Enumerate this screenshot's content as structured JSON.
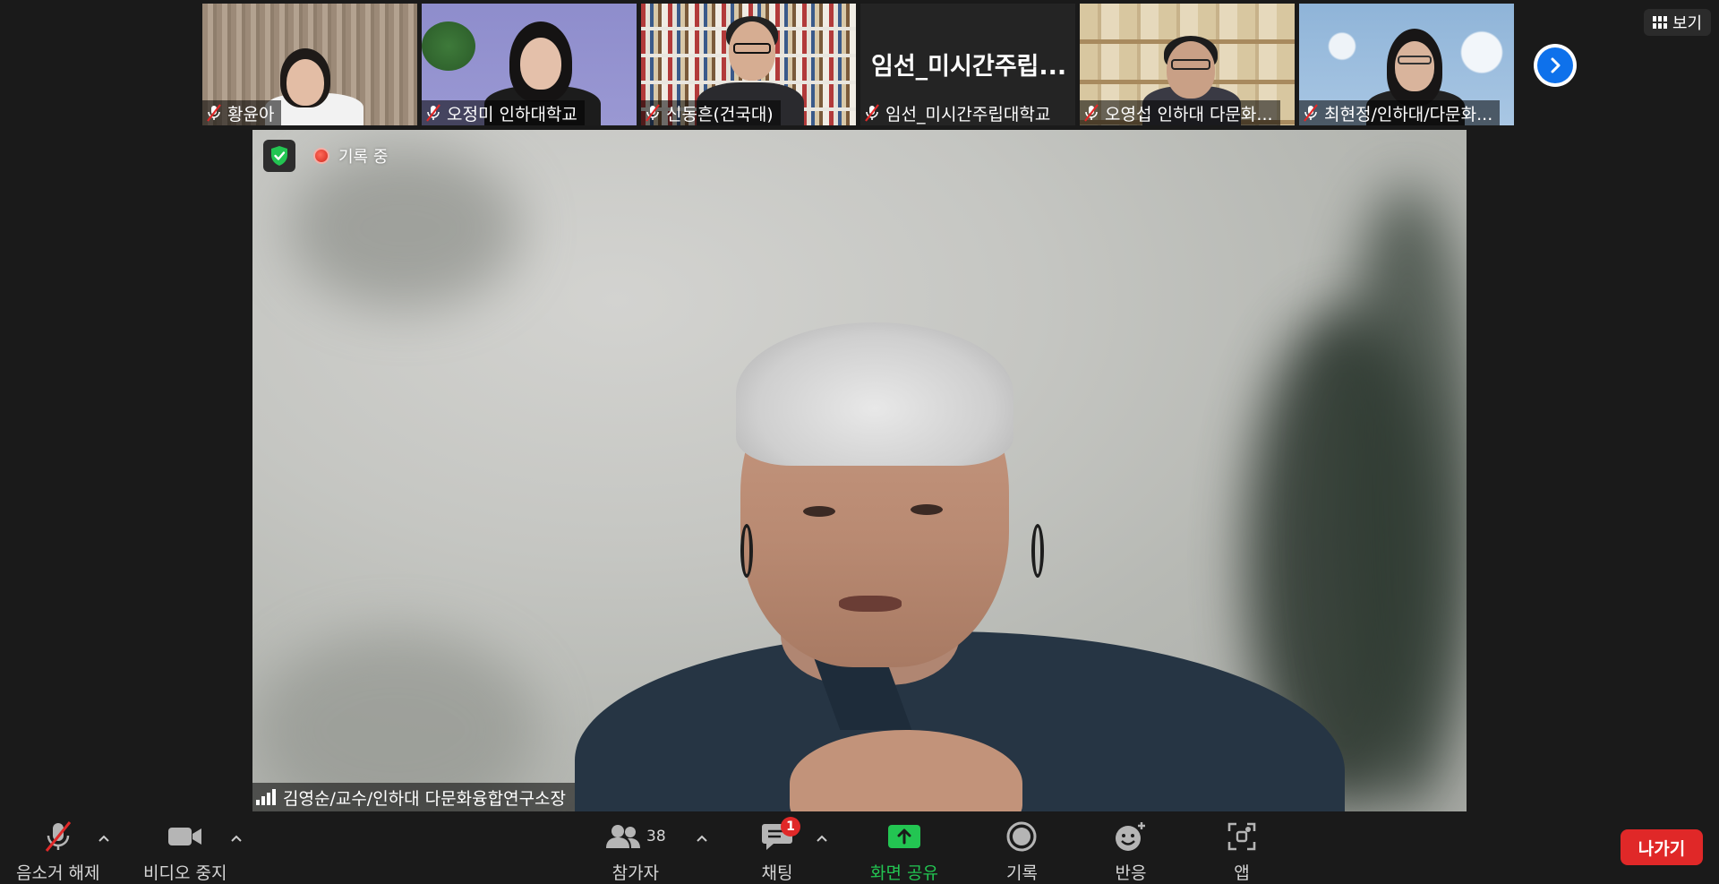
{
  "participants": [
    {
      "name": "황윤아",
      "muted": true
    },
    {
      "name": "오정미 인하대학교",
      "muted": true
    },
    {
      "name": "신동흔(건국대)",
      "muted": true
    },
    {
      "name": "임선_미시간주립대학교",
      "muted": true,
      "video_off_text": "임선_미시간주립..."
    },
    {
      "name": "오영섭 인하대 다문화...",
      "muted": true
    },
    {
      "name": "최현정/인하대/다문화...",
      "muted": true
    }
  ],
  "view_button": {
    "label": "보기",
    "icon": "grid-icon"
  },
  "main_video": {
    "recording_label": "기록 중",
    "speaker_name": "김영순/교수/인하대 다문화융합연구소장",
    "security_icon": "shield-check-icon"
  },
  "toolbar": {
    "unmute_label": "음소거 해제",
    "video_label": "비디오 중지",
    "participants_label": "참가자",
    "participants_count": "38",
    "chat_label": "채팅",
    "chat_badge": "1",
    "share_label": "화면 공유",
    "record_label": "기록",
    "reactions_label": "반응",
    "apps_label": "앱",
    "leave_label": "나가기"
  },
  "colors": {
    "background": "#1a1a1a",
    "share_green": "#23c552",
    "leave_red": "#e02828",
    "accent_blue": "#0e71eb",
    "mute_red": "#e02828"
  }
}
